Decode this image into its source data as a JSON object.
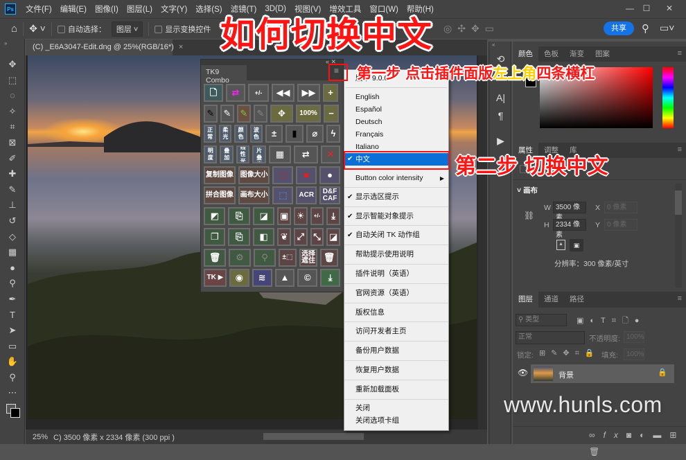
{
  "menubar": {
    "logo": "Ps",
    "items": [
      "文件(F)",
      "编辑(E)",
      "图像(I)",
      "图层(L)",
      "文字(Y)",
      "选择(S)",
      "滤镜(T)",
      "3D(D)",
      "视图(V)",
      "增效工具",
      "窗口(W)",
      "帮助(H)"
    ]
  },
  "window_controls": {
    "minimize": "—",
    "maximize": "☐",
    "close": "✕"
  },
  "options": {
    "auto_select_label": "自动选择：",
    "auto_select_value": "图层",
    "show_transform_label": "显示变换控件",
    "share_label": "共享"
  },
  "document": {
    "tab_title": "(C) _E6A3047-Edit.dng @ 25%(RGB/16*)",
    "tab_close": "×",
    "zoom": "25%",
    "status_info": "C) 3500 像素 x 2334 像素 (300 ppi )"
  },
  "tk_panel": {
    "title": "TK9 Combo",
    "rows": [
      [
        {
          "icon": "document",
          "color": "#3f5a5a"
        },
        {
          "icon": "swap-magenta",
          "color": "#555555"
        },
        {
          "icon": "plus-minus-color",
          "color": "#555555",
          "label": "+/-"
        },
        {
          "icon": "rewind",
          "color": "#555555"
        },
        {
          "icon": "fast-forward",
          "color": "#555555"
        },
        {
          "icon": "plus",
          "color": "#6b6b40"
        }
      ],
      [
        {
          "icon": "brush-black",
          "color": "#555555"
        },
        {
          "icon": "brush-white",
          "color": "#555555"
        },
        {
          "icon": "brush-green",
          "color": "#6b5040"
        },
        {
          "icon": "brush-gray",
          "color": "#555555"
        },
        {
          "icon": "expand",
          "color": "#6b6b40"
        },
        {
          "label": "100%",
          "color": "#6b6b40"
        },
        {
          "icon": "minus",
          "color": "#6b6b40"
        }
      ],
      [
        {
          "label": "正常",
          "color": "#4e5b6b"
        },
        {
          "label": "柔光",
          "color": "#4e5b6b"
        },
        {
          "label": "颜色",
          "color": "#4e5b6b"
        },
        {
          "label": "波色",
          "color": "#4e5b6b"
        },
        {
          "icon": "plus-minus-box",
          "color": "#555555"
        },
        {
          "icon": "black-frame",
          "color": "#555555"
        },
        {
          "icon": "paperclip",
          "color": "#555555"
        },
        {
          "icon": "lightning",
          "color": "#555555"
        }
      ],
      [
        {
          "label": "明度",
          "color": "#4e5b6b"
        },
        {
          "label": "叠加",
          "color": "#4e5b6b"
        },
        {
          "label": "线性光",
          "color": "#4e5b6b"
        },
        {
          "label": "正片叠底",
          "color": "#4e5b6b"
        },
        {
          "icon": "calculator",
          "color": "#555555"
        },
        {
          "icon": "swap-white",
          "color": "#555555"
        },
        {
          "icon": "red-x",
          "color": "#555555"
        }
      ],
      [
        {
          "label": "复制图像",
          "color": "#5e4a42"
        },
        {
          "label": "图像大小",
          "color": "#5e4a42"
        },
        {
          "icon": "square-outline-red",
          "color": "#55506b"
        },
        {
          "icon": "square-filled-red",
          "color": "#55506b"
        },
        {
          "icon": "drop",
          "color": "#55506b"
        }
      ],
      [
        {
          "label": "拼合图像",
          "color": "#5e4a42"
        },
        {
          "label": "画布大小",
          "color": "#5e4a42"
        },
        {
          "icon": "selection-box",
          "color": "#55506b"
        },
        {
          "label": "ACR",
          "color": "#55506b"
        },
        {
          "label": "D&F CAF",
          "color": "#55506b"
        }
      ],
      [
        {
          "icon": "layer-fold",
          "color": "#3f5a40"
        },
        {
          "icon": "smart-object",
          "color": "#3f5a40"
        },
        {
          "icon": "mask-leaf",
          "color": "#3f5a40"
        },
        {
          "icon": "portrait",
          "color": "#5e4545"
        },
        {
          "icon": "sun-cloud",
          "color": "#5e4545"
        },
        {
          "label": "+/-",
          "color": "#5e4545"
        },
        {
          "icon": "stamp-down",
          "color": "#5e4545"
        }
      ],
      [
        {
          "icon": "layers-stack",
          "color": "#3f5a40"
        },
        {
          "icon": "duplicate",
          "color": "#3f5a40"
        },
        {
          "icon": "half-fill",
          "color": "#3f5a40"
        },
        {
          "icon": "feather",
          "color": "#5e4545"
        },
        {
          "icon": "arrows-out",
          "color": "#5e4545"
        },
        {
          "icon": "arrows-in",
          "color": "#5e4545"
        },
        {
          "icon": "leaf-mask",
          "color": "#5e4545"
        }
      ],
      [
        {
          "icon": "trash",
          "color": "#3f5a40"
        },
        {
          "icon": "gear-gray",
          "color": "#3f5a40"
        },
        {
          "icon": "magnifier-gray",
          "color": "#3f5a40"
        },
        {
          "label": "±⬚",
          "color": "#5e4545"
        },
        {
          "label": "选择遮住",
          "color": "#5e4545"
        },
        {
          "icon": "trash",
          "color": "#5e4545"
        }
      ],
      [
        {
          "label": "TK ▶",
          "color": "#6b4545"
        },
        {
          "icon": "eye",
          "color": "#6b6b40"
        },
        {
          "icon": "layers",
          "color": "#45457a"
        },
        {
          "icon": "triangle",
          "color": "#555555"
        },
        {
          "icon": "copyright",
          "color": "#555555"
        },
        {
          "icon": "download",
          "color": "#3f6a45"
        }
      ]
    ]
  },
  "dropdown": {
    "version": "版本 9.0.0",
    "languages": [
      "English",
      "Español",
      "Deutsch",
      "Français",
      "Italiano"
    ],
    "selected_language": "中文",
    "check": "✔",
    "button_color": "Button color intensity",
    "submenu_arrow": "▶",
    "options": [
      {
        "label": "显示选区提示",
        "checked": true
      },
      {
        "label": "显示智能对象提示",
        "checked": true
      },
      {
        "label": "自动关闭 TK 动作组",
        "checked": true
      },
      {
        "label": "帮助提示使用说明",
        "checked": false
      },
      {
        "label": "插件说明（英语）",
        "checked": false
      },
      {
        "label": "官网资源（英语）",
        "checked": false
      },
      {
        "label": "版权信息",
        "checked": false
      },
      {
        "label": "访问开发者主页",
        "checked": false
      },
      {
        "label": "备份用户数据",
        "checked": false
      },
      {
        "label": "恢复用户数据",
        "checked": false
      },
      {
        "label": "重新加载面板",
        "checked": false
      }
    ],
    "close": "关闭",
    "close_tab_group": "关闭选项卡组"
  },
  "color_panel": {
    "tabs": [
      "颜色",
      "色板",
      "渐变",
      "图案"
    ]
  },
  "properties_panel": {
    "tabs": [
      "属性",
      "调整",
      "库"
    ],
    "section": "画布",
    "w_label": "W",
    "w_value": "3500 像素",
    "h_label": "H",
    "h_value": "2334 像素",
    "x_label": "X",
    "x_value": "0 像素",
    "y_label": "Y",
    "y_value": "0 像素",
    "resolution": "分辨率：300 像素/英寸"
  },
  "layers_panel": {
    "tabs": [
      "图层",
      "通道",
      "路径"
    ],
    "filter_placeholder": "类型",
    "blend_mode": "正常",
    "opacity_label": "不透明度:",
    "opacity_value": "100%",
    "lock_label": "锁定:",
    "fill_label": "填充:",
    "fill_value": "100%",
    "layers": [
      {
        "name": "背景",
        "visible": true,
        "locked": true
      }
    ],
    "footer_icons": [
      "link",
      "fx",
      "mask",
      "adjustment",
      "folder",
      "new-layer",
      "trash"
    ]
  },
  "annotations": {
    "title": "如何切换中文",
    "step1_a": "第一步 点击插件面版",
    "step1_b": "左上角",
    "step1_c": "四条横杠",
    "step2": "第二步 切换中文"
  },
  "watermark": "www.hunls.com"
}
